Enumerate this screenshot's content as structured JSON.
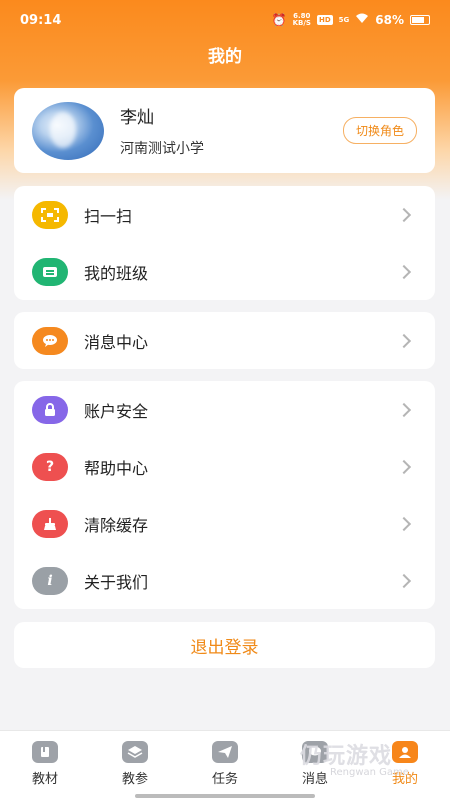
{
  "status_bar": {
    "time": "09:14",
    "net_speed_top": "6.80",
    "net_speed_bottom": "KB/S",
    "hd": "HD",
    "signal": "5G",
    "battery": "68%"
  },
  "header": {
    "title": "我的"
  },
  "profile": {
    "name": "李灿",
    "school": "河南测试小学",
    "switch_role_label": "切换角色"
  },
  "menu_group_1": [
    {
      "label": "扫一扫",
      "icon": "scan-icon",
      "color": "#f5b800"
    },
    {
      "label": "我的班级",
      "icon": "class-icon",
      "color": "#21b573"
    }
  ],
  "menu_group_2": [
    {
      "label": "消息中心",
      "icon": "message-icon",
      "color": "#f5891f"
    }
  ],
  "menu_group_3": [
    {
      "label": "账户安全",
      "icon": "lock-icon",
      "color": "#8667e8"
    },
    {
      "label": "帮助中心",
      "icon": "help-icon",
      "color": "#ee5050"
    },
    {
      "label": "清除缓存",
      "icon": "broom-icon",
      "color": "#ee5050"
    },
    {
      "label": "关于我们",
      "icon": "info-icon",
      "color": "#9aa0a6"
    }
  ],
  "logout_label": "退出登录",
  "tabbar": [
    {
      "label": "教材",
      "icon": "book-icon"
    },
    {
      "label": "教参",
      "icon": "layers-icon"
    },
    {
      "label": "任务",
      "icon": "send-icon"
    },
    {
      "label": "消息",
      "icon": "chat-icon"
    },
    {
      "label": "我的",
      "icon": "profile-icon",
      "active": true
    }
  ],
  "watermark": {
    "text": "仍玩游戏",
    "sub": "Rengwan Game"
  },
  "colors": {
    "accent": "#f08a18",
    "header": "#fb8a1d"
  }
}
